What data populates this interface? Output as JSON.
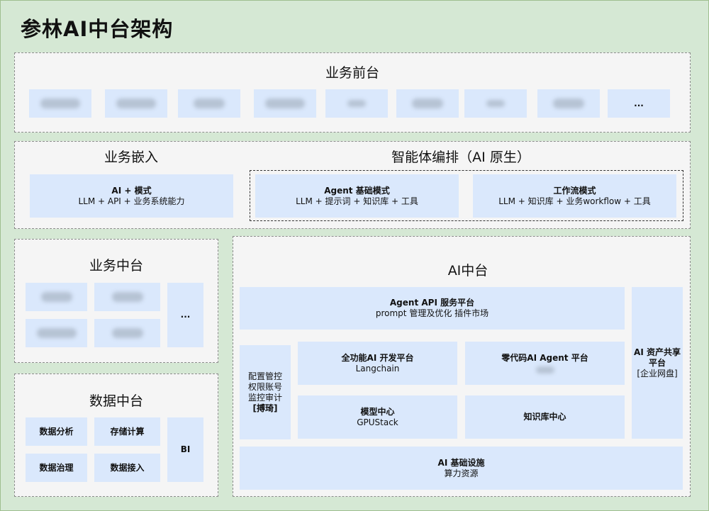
{
  "title": "参林AI中台架构",
  "front": {
    "title": "业务前台",
    "more": "..."
  },
  "embed": {
    "title": "业务嵌入",
    "box_title": "AI + 模式",
    "box_sub": "LLM + API + 业务系统能力"
  },
  "agent": {
    "title": "智能体编排（AI 原生）",
    "basic_title": "Agent 基础模式",
    "basic_sub": "LLM + 提示词 + 知识库 + 工具",
    "workflow_title": "工作流模式",
    "workflow_sub": "LLM + 知识库 + 业务workflow + 工具"
  },
  "biz_mid": {
    "title": "业务中台",
    "more": "..."
  },
  "data_mid": {
    "title": "数据中台",
    "items": [
      "数据分析",
      "存储计算",
      "数据治理",
      "数据接入"
    ],
    "bi": "BI"
  },
  "ai_mid": {
    "title": "AI中台",
    "api_title": "Agent API 服务平台",
    "api_sub": "prompt 管理及优化  插件市场",
    "side_lines": [
      "配置管控",
      "权限账号",
      "监控审计"
    ],
    "side_bold": "[搏琦]",
    "full_title": "全功能AI 开发平台",
    "full_sub": "Langchain",
    "zero_title": "零代码AI Agent 平台",
    "model_title": "模型中心",
    "model_sub": "GPUStack",
    "kb_title": "知识库中心",
    "asset_title_1": "AI 资产共享",
    "asset_title_2": "平台",
    "asset_sub": "[企业网盘]",
    "infra_title": "AI 基础设施",
    "infra_sub": "算力资源"
  }
}
